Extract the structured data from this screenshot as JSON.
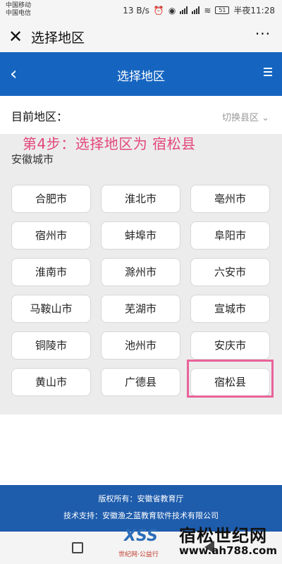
{
  "status_bar": {
    "carrier1": "中国移动",
    "carrier2": "中国电信",
    "speed": "13 B/s",
    "battery": "51",
    "time": "半夜11:28"
  },
  "wechat_bar": {
    "close_icon": "close-icon",
    "title": "选择地区",
    "more_label": "···"
  },
  "header": {
    "back_icon": "chevron-left-icon",
    "title": "选择地区",
    "menu_icon": "hamburger-icon",
    "color": "#1565c0"
  },
  "current": {
    "label": "目前地区：",
    "switch_label": "切换县区 ⌄"
  },
  "annotation": {
    "text": "第4步：选择地区为  宿松县",
    "color": "#e3477c"
  },
  "province_label": "安徽城市",
  "cities": [
    "合肥市",
    "淮北市",
    "亳州市",
    "宿州市",
    "蚌埠市",
    "阜阳市",
    "淮南市",
    "滁州市",
    "六安市",
    "马鞍山市",
    "芜湖市",
    "宣城市",
    "铜陵市",
    "池州市",
    "安庆市",
    "黄山市",
    "广德县",
    "宿松县"
  ],
  "highlighted_city": "宿松县",
  "footer": {
    "copyright": "版权所有：安徽省教育厅",
    "support": "技术支持：安徽渔之蓝教育软件技术有限公司"
  },
  "watermark": {
    "logo": "XSS",
    "tagline": "世纪网·公益行",
    "name": "宿松世纪网",
    "url": "www.ah788.com"
  }
}
